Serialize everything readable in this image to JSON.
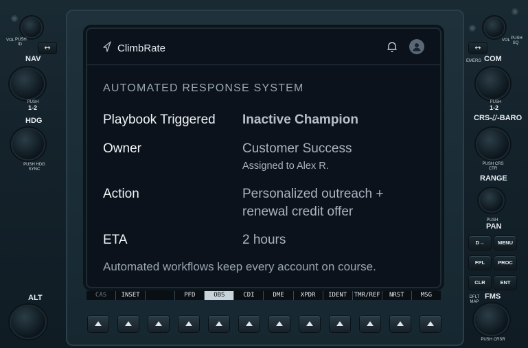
{
  "app": {
    "brand": "ClimbRate"
  },
  "icons": {
    "brand": "paper-plane-icon",
    "notifications": "bell-icon",
    "user": "user-avatar-icon"
  },
  "panel": {
    "section_title": "AUTOMATED RESPONSE SYSTEM",
    "rows": [
      {
        "label": "Playbook Triggered",
        "value": "Inactive Champion"
      },
      {
        "label": "Owner",
        "value": "Customer Success",
        "sub": "Assigned to Alex R."
      },
      {
        "label": "Action",
        "value_line1": "Personalized outreach +",
        "value_line2": "renewal credit offer"
      },
      {
        "label": "ETA",
        "value": "2 hours"
      }
    ],
    "footer": "Automated workflows keep every account on course."
  },
  "softkeys": [
    "CAS",
    "INSET",
    "",
    "PFD",
    "OBS",
    "CDI",
    "DME",
    "XPDR",
    "IDENT",
    "TMR/REF",
    "NRST",
    "MSG"
  ],
  "bezel": {
    "left": {
      "vol_label": "VOL",
      "push_id": "PUSH ID",
      "nav": "NAV",
      "nav_push": "PUSH",
      "nav_12": "1-2",
      "hdg": "HDG",
      "hdg_push": "PUSH HDG SYNC",
      "alt": "ALT"
    },
    "right": {
      "vol_label": "VOL",
      "push_sq": "PUSH SQ",
      "emerg": "EMERG",
      "com": "COM",
      "com_push": "PUSH",
      "com_12": "1-2",
      "crs_baro": "CRS-⌰-BARO",
      "crs_push": "PUSH CRS CTR",
      "range": "RANGE",
      "pan_push": "PUSH",
      "pan": "PAN",
      "buttons": [
        "D→",
        "MENU",
        "FPL",
        "PROC",
        "CLR",
        "ENT"
      ],
      "dflt_map": "DFLT MAP",
      "fms": "FMS",
      "push_crsr": "PUSH CRSR"
    },
    "swap_glyph": "↔"
  }
}
